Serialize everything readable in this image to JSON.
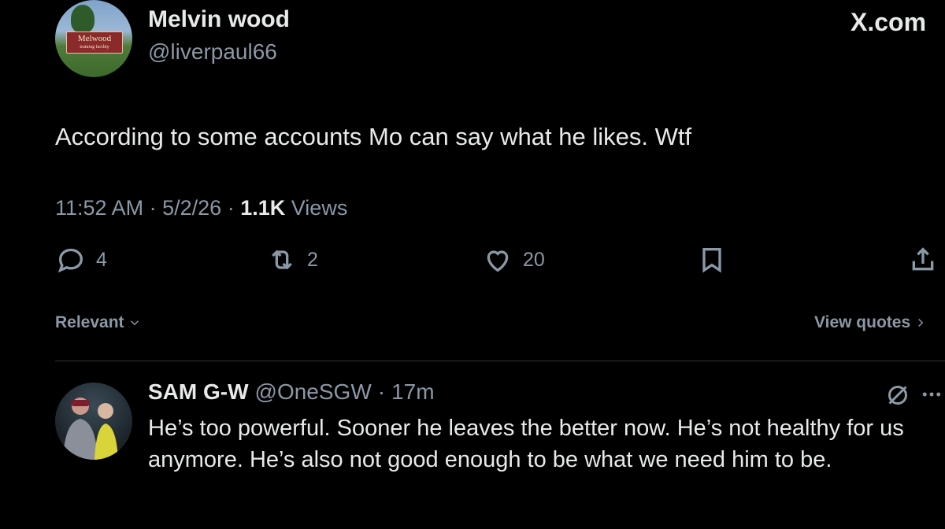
{
  "site": {
    "brand": "X.com"
  },
  "tweet": {
    "author_name": "Melvin wood",
    "author_handle": "@liverpaul66",
    "avatar_sign_text": "Melwood",
    "avatar_sign_subtext": "training facility",
    "text": "According to some accounts Mo can say what he likes. Wtf",
    "time": "11:52 AM",
    "sep1": "·",
    "date": "5/2/26",
    "sep2": "·",
    "views_count": "1.1K",
    "views_label": "Views",
    "replies": "4",
    "reposts": "2",
    "likes": "20"
  },
  "sort": {
    "relevant_label": "Relevant",
    "view_quotes_label": "View quotes"
  },
  "reply": {
    "author_name": "SAM G-W",
    "author_handle": "@OneSGW",
    "sep": "·",
    "age": "17m",
    "text": "He’s too powerful. Sooner he leaves the better now. He’s not healthy for us anymore. He’s also not good enough to be what we need him to be."
  },
  "icons": {
    "reply": "reply-icon",
    "repost": "repost-icon",
    "like": "heart-icon",
    "bookmark": "bookmark-icon",
    "share": "share-icon",
    "grok": "grok-icon",
    "more": "more-icon",
    "chevron_down": "chevron-down-icon",
    "chevron_right": "chevron-right-icon"
  }
}
